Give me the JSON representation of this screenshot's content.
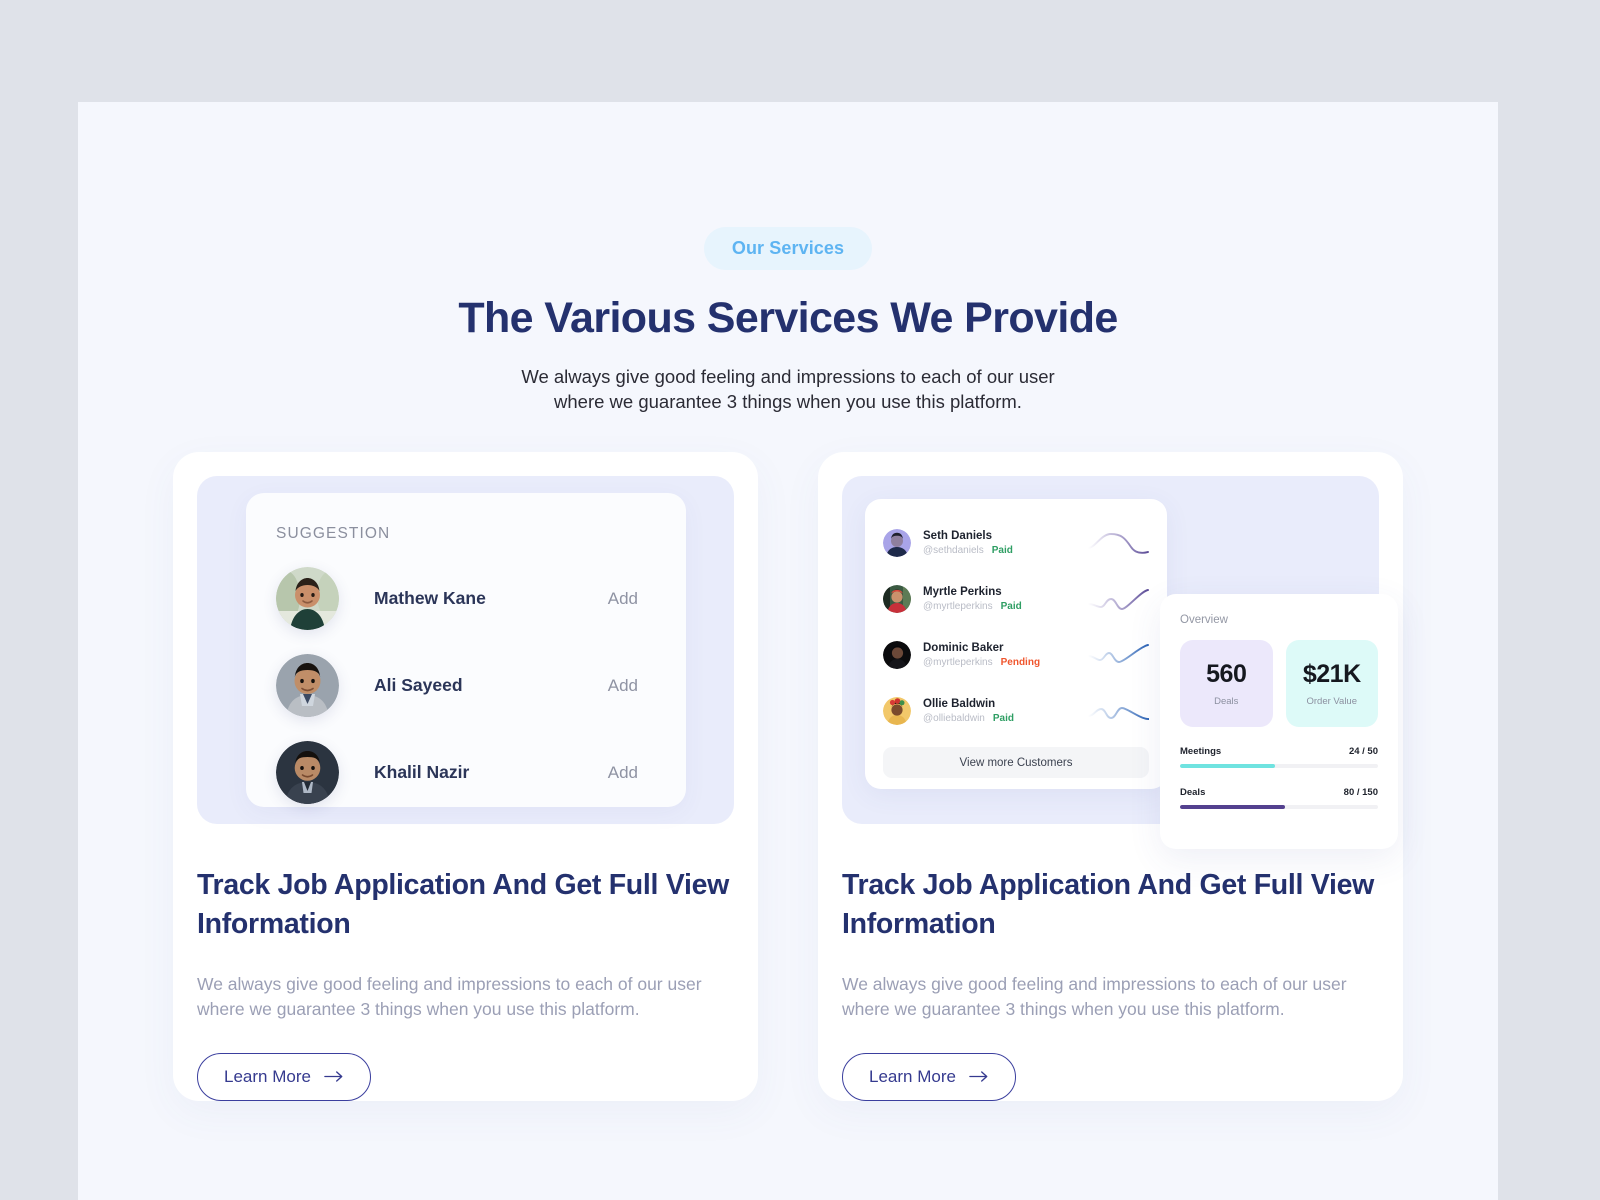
{
  "header": {
    "pill": "Our Services",
    "title": "The Various Services We Provide",
    "subtitle_line1": "We always give good feeling and impressions to each of our user",
    "subtitle_line2": "where we guarantee 3 things when you use this platform."
  },
  "colors": {
    "page_bg": "#f5f7fd",
    "outer_bg": "#dfe2e9",
    "brand_navy": "#24316e",
    "pill_bg": "#e7f4fd",
    "pill_text": "#5eb4f2",
    "mock_bg": "#e9ecfb",
    "paid": "#2e9e63",
    "pending": "#f0562e",
    "meetings_bar": "#6fe3e0",
    "deals_bar": "#54418f",
    "tile_deals_bg": "#ece8fb",
    "tile_order_bg": "#ddfaf8"
  },
  "left_card": {
    "suggestion_heading": "SUGGESTION",
    "suggestions": [
      {
        "name": "Mathew Kane",
        "action": "Add"
      },
      {
        "name": "Ali Sayeed",
        "action": "Add"
      },
      {
        "name": "Khalil Nazir",
        "action": "Add"
      }
    ],
    "title": "Track Job Application And Get Full View Information",
    "description": "We always give good feeling and impressions to each of our user where we guarantee 3 things when you use this platform.",
    "cta": "Learn More"
  },
  "right_card": {
    "customers": [
      {
        "name": "Seth Daniels",
        "handle": "@sethdaniels",
        "status": "Paid",
        "status_type": "paid"
      },
      {
        "name": "Myrtle Perkins",
        "handle": "@myrtleperkins",
        "status": "Paid",
        "status_type": "paid"
      },
      {
        "name": "Dominic Baker",
        "handle": "@myrtleperkins",
        "status": "Pending",
        "status_type": "pending"
      },
      {
        "name": "Ollie Baldwin",
        "handle": "@olliebaldwin",
        "status": "Paid",
        "status_type": "paid"
      }
    ],
    "view_more": "View more Customers",
    "overview": {
      "label": "Overview",
      "tiles": [
        {
          "value": "560",
          "label": "Deals"
        },
        {
          "value": "$21K",
          "label": "Order Value"
        }
      ],
      "bars": [
        {
          "label": "Meetings",
          "value": "24 / 50",
          "percent": 48
        },
        {
          "label": "Deals",
          "value": "80 / 150",
          "percent": 53
        }
      ]
    },
    "title": "Track Job Application And Get Full View Information",
    "description": "We always give good feeling and impressions to each of our user where we guarantee 3 things when you use this platform.",
    "cta": "Learn More"
  }
}
